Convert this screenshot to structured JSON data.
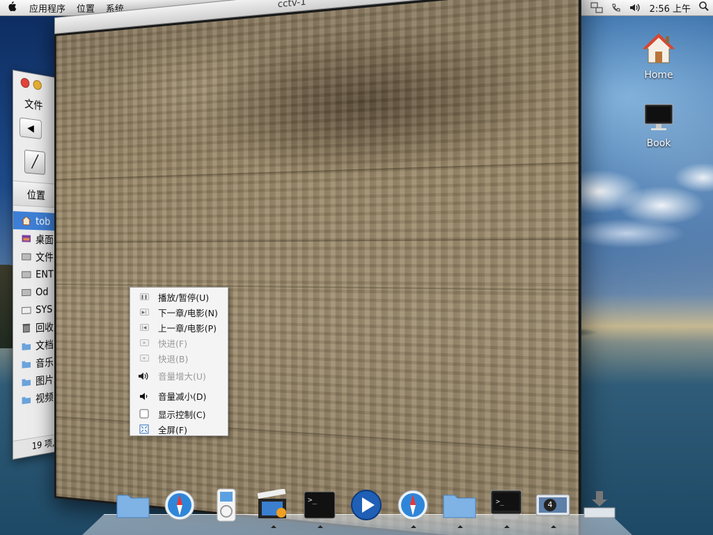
{
  "menubar": {
    "items": [
      "应用程序",
      "位置",
      "系统"
    ],
    "clock": "2:56 上午",
    "tray_icons": [
      "flag-icon",
      "network-icon",
      "phone-icon",
      "volume-icon"
    ]
  },
  "desktop": {
    "icons": [
      {
        "label": "Home",
        "icon": "house-icon"
      },
      {
        "label": "Book",
        "icon": "computer-icon"
      }
    ]
  },
  "files_window": {
    "menu_file": "文件",
    "places_header": "位置",
    "places": [
      {
        "label": "tob",
        "icon": "home-folder-icon",
        "selected": true
      },
      {
        "label": "桌面",
        "icon": "desktop-icon"
      },
      {
        "label": "文件",
        "icon": "drive-icon"
      },
      {
        "label": "ENT",
        "icon": "drive-icon"
      },
      {
        "label": "Od",
        "icon": "drive-icon"
      },
      {
        "label": "SYS",
        "icon": "drive-icon"
      },
      {
        "label": "回收",
        "icon": "trash-icon"
      },
      {
        "label": "文档",
        "icon": "folder-icon"
      },
      {
        "label": "音乐",
        "icon": "folder-icon"
      },
      {
        "label": "图片",
        "icon": "folder-icon"
      },
      {
        "label": "视频",
        "icon": "folder-icon"
      }
    ],
    "status": "19 项,"
  },
  "video_window": {
    "title": "cctv-1"
  },
  "context_menu": {
    "items": [
      {
        "label": "播放/暂停(U)",
        "icon": "play-pause-icon",
        "enabled": true
      },
      {
        "label": "下一章/电影(N)",
        "icon": "next-chapter-icon",
        "enabled": true
      },
      {
        "label": "上一章/电影(P)",
        "icon": "previous-chapter-icon",
        "enabled": true
      },
      {
        "label": "快进(F)",
        "icon": "fast-forward-icon",
        "enabled": false
      },
      {
        "label": "快退(B)",
        "icon": "rewind-icon",
        "enabled": false
      },
      {
        "label": "音量增大(U)",
        "icon": "volume-up-icon",
        "enabled": false
      },
      {
        "label": "音量减小(D)",
        "icon": "volume-down-icon",
        "enabled": true
      },
      {
        "label": "显示控制(C)",
        "icon": "checkbox-icon",
        "enabled": true
      },
      {
        "label": "全屏(F)",
        "icon": "fullscreen-icon",
        "enabled": true
      }
    ]
  },
  "dock": {
    "items": [
      {
        "name": "folder",
        "icon": "folder-icon"
      },
      {
        "name": "safari",
        "icon": "compass-icon"
      },
      {
        "name": "ipod",
        "icon": "ipod-icon"
      },
      {
        "name": "video-player",
        "icon": "clapperboard-icon",
        "running": true
      },
      {
        "name": "terminal",
        "icon": "terminal-icon",
        "running": true
      },
      {
        "name": "media-player",
        "icon": "play-circle-icon"
      },
      {
        "name": "safari",
        "icon": "compass-icon",
        "running": true
      },
      {
        "name": "folder",
        "icon": "folder-icon",
        "running": true
      },
      {
        "name": "terminal",
        "icon": "terminal-icon",
        "running": true
      },
      {
        "name": "workspaces",
        "icon": "workspace-icon",
        "badge": "4",
        "running": true
      },
      {
        "name": "downloads",
        "icon": "download-tray-icon"
      }
    ]
  },
  "colors": {
    "accent": "#3d7fd6",
    "menu_bg": "#f4f4f4",
    "disabled_text": "#9a9a9a"
  }
}
